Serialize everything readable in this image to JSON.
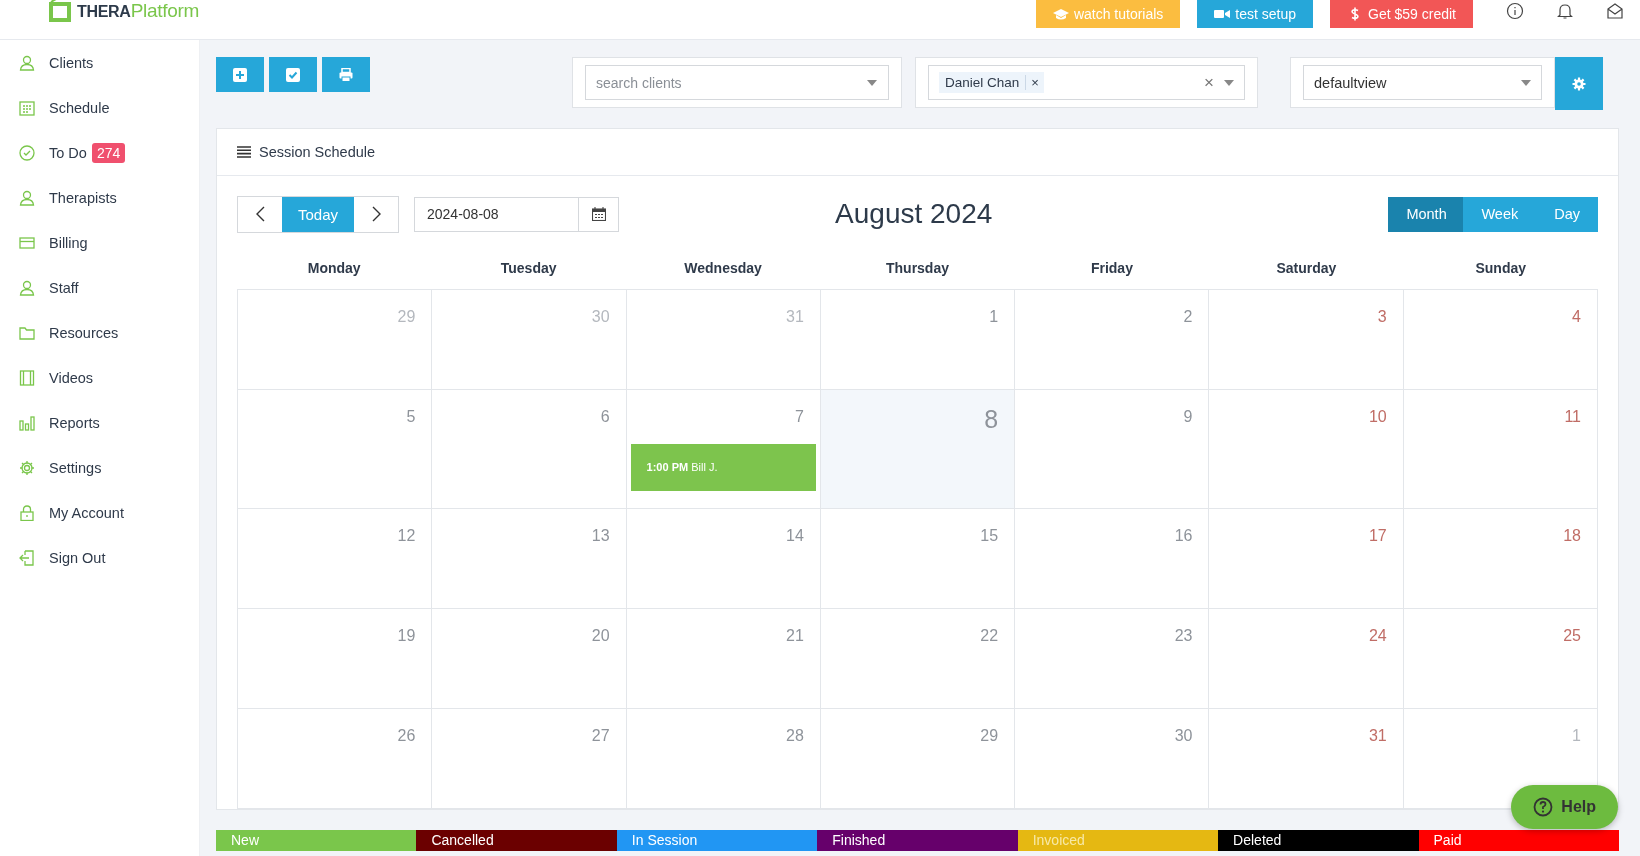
{
  "logo": {
    "text": "**THERA**Platform"
  },
  "header_buttons": [
    {
      "label": "watch tutorials",
      "color": "#fbbd40"
    },
    {
      "label": "test setup",
      "color": "#26a7d9"
    },
    {
      "label": "Get $59 credit",
      "color": "#f25656"
    }
  ],
  "sidebar": {
    "items": [
      {
        "label": "Clients"
      },
      {
        "label": "Schedule"
      },
      {
        "label": "To Do",
        "badge": "274"
      },
      {
        "label": "Therapists"
      },
      {
        "label": "Billing"
      },
      {
        "label": "Staff"
      },
      {
        "label": "Resources"
      },
      {
        "label": "Videos"
      },
      {
        "label": "Reports"
      },
      {
        "label": "Settings"
      },
      {
        "label": "My Account"
      },
      {
        "label": "Sign Out"
      }
    ]
  },
  "filters": {
    "search": {
      "placeholder": "search clients"
    },
    "clients": {
      "tags": [
        {
          "label": "Daniel Chan",
          "remove": "×"
        }
      ],
      "clear": "×"
    },
    "view": {
      "value": "defaultview"
    }
  },
  "card": {
    "title": "Session Schedule"
  },
  "calendar": {
    "today_button": "Today",
    "date": "2024-08-08",
    "title": "August 2024",
    "views": [
      {
        "label": "Month",
        "selected": true
      },
      {
        "label": "Week",
        "selected": false
      },
      {
        "label": "Day",
        "selected": false
      }
    ],
    "weekdays": [
      "Monday",
      "Tuesday",
      "Wednesday",
      "Thursday",
      "Friday",
      "Saturday",
      "Sunday"
    ],
    "weeks": [
      [
        {
          "date": "29",
          "other_month": true,
          "weekend": false,
          "today": false
        },
        {
          "date": "30",
          "other_month": true,
          "weekend": false,
          "today": false
        },
        {
          "date": "31",
          "other_month": true,
          "weekend": false,
          "today": false
        },
        {
          "date": "1",
          "other_month": false,
          "weekend": false,
          "today": false
        },
        {
          "date": "2",
          "other_month": false,
          "weekend": false,
          "today": false
        },
        {
          "date": "3",
          "other_month": false,
          "weekend": true,
          "today": false
        },
        {
          "date": "4",
          "other_month": false,
          "weekend": true,
          "today": false
        }
      ],
      [
        {
          "date": "5",
          "other_month": false,
          "weekend": false,
          "today": false
        },
        {
          "date": "6",
          "other_month": false,
          "weekend": false,
          "today": false
        },
        {
          "date": "7",
          "other_month": false,
          "weekend": false,
          "today": false,
          "events": [
            {
              "text": "**1:00 PM** Bill J.",
              "color": "#7dc44d"
            }
          ]
        },
        {
          "date": "8",
          "other_month": false,
          "weekend": false,
          "today": true
        },
        {
          "date": "9",
          "other_month": false,
          "weekend": false,
          "today": false
        },
        {
          "date": "10",
          "other_month": false,
          "weekend": true,
          "today": false
        },
        {
          "date": "11",
          "other_month": false,
          "weekend": true,
          "today": false
        }
      ],
      [
        {
          "date": "12",
          "other_month": false,
          "weekend": false,
          "today": false
        },
        {
          "date": "13",
          "other_month": false,
          "weekend": false,
          "today": false
        },
        {
          "date": "14",
          "other_month": false,
          "weekend": false,
          "today": false
        },
        {
          "date": "15",
          "other_month": false,
          "weekend": false,
          "today": false
        },
        {
          "date": "16",
          "other_month": false,
          "weekend": false,
          "today": false
        },
        {
          "date": "17",
          "other_month": false,
          "weekend": true,
          "today": false
        },
        {
          "date": "18",
          "other_month": false,
          "weekend": true,
          "today": false
        }
      ],
      [
        {
          "date": "19",
          "other_month": false,
          "weekend": false,
          "today": false
        },
        {
          "date": "20",
          "other_month": false,
          "weekend": false,
          "today": false
        },
        {
          "date": "21",
          "other_month": false,
          "weekend": false,
          "today": false
        },
        {
          "date": "22",
          "other_month": false,
          "weekend": false,
          "today": false
        },
        {
          "date": "23",
          "other_month": false,
          "weekend": false,
          "today": false
        },
        {
          "date": "24",
          "other_month": false,
          "weekend": true,
          "today": false
        },
        {
          "date": "25",
          "other_month": false,
          "weekend": true,
          "today": false
        }
      ],
      [
        {
          "date": "26",
          "other_month": false,
          "weekend": false,
          "today": false
        },
        {
          "date": "27",
          "other_month": false,
          "weekend": false,
          "today": false
        },
        {
          "date": "28",
          "other_month": false,
          "weekend": false,
          "today": false
        },
        {
          "date": "29",
          "other_month": false,
          "weekend": false,
          "today": false
        },
        {
          "date": "30",
          "other_month": false,
          "weekend": false,
          "today": false
        },
        {
          "date": "31",
          "other_month": false,
          "weekend": true,
          "today": false
        },
        {
          "date": "1",
          "other_month": true,
          "weekend": true,
          "today": false
        }
      ]
    ]
  },
  "legend": [
    {
      "label": "New",
      "color": "#7ac64b"
    },
    {
      "label": "Cancelled",
      "color": "#6b0000"
    },
    {
      "label": "In Session",
      "color": "#2196f3"
    },
    {
      "label": "Finished",
      "color": "#66006b"
    },
    {
      "label": "Invoiced",
      "color": "#e5b812"
    },
    {
      "label": "Deleted",
      "color": "#000000"
    },
    {
      "label": "Paid",
      "color": "#ff0000"
    }
  ],
  "help": {
    "label": "Help"
  }
}
